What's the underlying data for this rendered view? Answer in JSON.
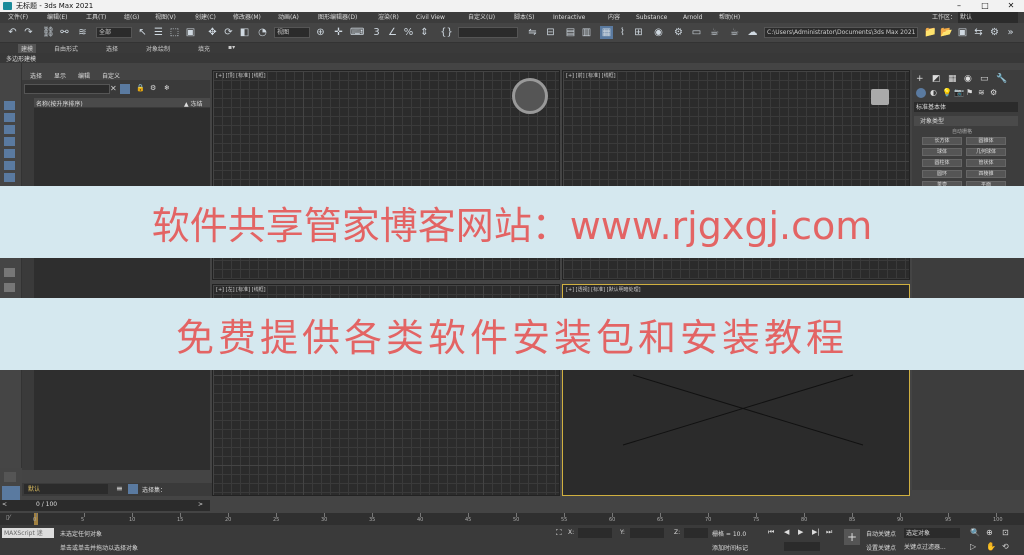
{
  "window": {
    "title": "无标题 - 3ds Max 2021"
  },
  "menu": [
    "文件(F)",
    "编辑(E)",
    "工具(T)",
    "组(G)",
    "视图(V)",
    "创建(C)",
    "修改器(M)",
    "动画(A)",
    "图形编辑器(D)",
    "渲染(R)",
    "Civil View",
    "自定义(U)",
    "脚本(S)",
    "Interactive",
    "内容",
    "Substance",
    "Arnold",
    "帮助(H)"
  ],
  "menu_right": {
    "workspace": "工作区：",
    "workspace_value": "默认"
  },
  "toolbar": {
    "selection_filter": "全部",
    "view_ref": "视图",
    "path": "C:\\Users\\Administrator\\Documents\\3ds Max 2021"
  },
  "ribbon": [
    "建模",
    "自由形式",
    "选择",
    "对象绘制",
    "填充"
  ],
  "polybar": "多边形建模",
  "scene_explorer": {
    "tabs": [
      "选择",
      "显示",
      "编辑",
      "自定义"
    ],
    "col_name": "名称(按升序排序)",
    "col_frozen": "▲ 冻结"
  },
  "viewports": [
    {
      "label": "[+] [顶] [标准] [线框]"
    },
    {
      "label": "[+] [前] [标准] [线框]"
    },
    {
      "label": "[+] [左] [标准] [线框]"
    },
    {
      "label": "[+] [透视] [标准] [默认明暗处理]"
    }
  ],
  "command_panel": {
    "dropdown": "标准基本体",
    "rollout": "对象类型",
    "autogrid": "自动栅格",
    "buttons": [
      "长方体",
      "圆锥体",
      "球体",
      "几何球体",
      "圆柱体",
      "管状体",
      "圆环",
      "四棱锥",
      "茶壶",
      "平面"
    ]
  },
  "banner": {
    "line1": "软件共享管家博客网站：www.rjgxgj.com",
    "line2": "免费提供各类软件安装包和安装教程"
  },
  "layer": {
    "name": "默认",
    "selection_set": "选择集："
  },
  "frame": {
    "current": "0 / 100"
  },
  "timeline": {
    "ticks": [
      "0",
      "5",
      "10",
      "15",
      "20",
      "25",
      "30",
      "35",
      "40",
      "45",
      "50",
      "55",
      "60",
      "65",
      "70",
      "75",
      "80",
      "85",
      "90",
      "95",
      "100"
    ]
  },
  "status": {
    "script": "MAXScript 迷",
    "msg1": "未选定任何对象",
    "msg2": "单击或单击并拖动以选择对象",
    "grid": "栅格 = 10.0",
    "autokey": "自动关键点",
    "setkey": "设置关键点",
    "sel_obj": "选定对象",
    "key_filter": "关键点过滤器...",
    "add_time_tag": "添加时间标记",
    "x": "X:",
    "y": "Y:",
    "z": "Z:"
  }
}
